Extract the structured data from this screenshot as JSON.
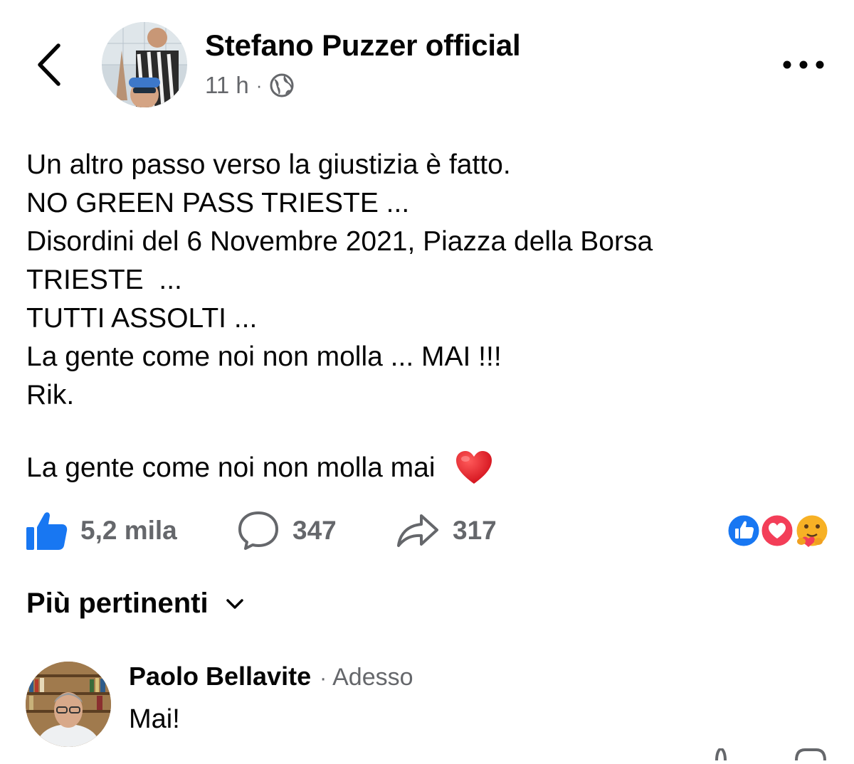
{
  "post": {
    "author": "Stefano Puzzer official",
    "time": "11 h",
    "separator": "·",
    "lines": [
      "Un altro passo verso la giustizia è fatto.",
      "NO GREEN PASS TRIESTE ...",
      "Disordini del 6 Novembre 2021, Piazza della Borsa",
      "TRIESTE  ...",
      "TUTTI ASSOLTI ...",
      "La gente come noi non molla ... MAI !!!",
      "Rik."
    ],
    "closing_line": "La gente come noi non molla mai "
  },
  "actions": {
    "likes": "5,2 mila",
    "comments": "347",
    "shares": "317"
  },
  "sort": {
    "label": "Più pertinenti"
  },
  "comment": {
    "author": "Paolo Bellavite",
    "separator": "·",
    "time": "Adesso",
    "text": "Mai!"
  },
  "icons": {
    "back": "chevron-left-icon",
    "more": "more-horizontal-icon",
    "privacy": "globe-icon",
    "like": "thumbs-up-icon",
    "comment": "comment-bubble-icon",
    "share": "share-arrow-icon",
    "heart": "red-heart-emoji",
    "sort": "chevron-down-icon"
  },
  "colors": {
    "like_blue": "#1877f2",
    "love_red": "#f33e58",
    "care_yellow": "#f7b125",
    "secondary_text": "#65676b",
    "primary_text": "#050505"
  }
}
